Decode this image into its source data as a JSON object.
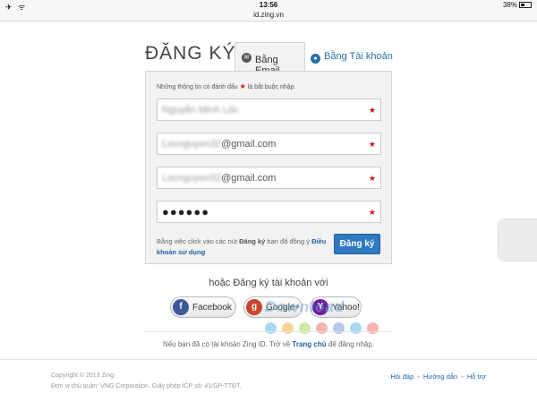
{
  "status_bar": {
    "signal": "✈ ᯤ",
    "time": "13:56",
    "battery": "38%"
  },
  "browser": {
    "url": "id.zing.vn"
  },
  "page": {
    "title": "ĐĂNG KÝ"
  },
  "tabs": [
    {
      "label": "Bằng Email",
      "icon": "mail-icon",
      "active": true
    },
    {
      "label": "Bằng Tài khoản",
      "icon": "user-icon",
      "active": false
    }
  ],
  "form": {
    "required_note_prefix": "Những thông tin có đánh dấu",
    "required_note_suffix": "là bắt buộc nhập.",
    "required_mark": "★",
    "fields": [
      {
        "name": "Nguyễn Minh Lộc",
        "visible_suffix": ""
      },
      {
        "prefix": "Locnguyen32",
        "visible_suffix": "@gmail.com"
      },
      {
        "prefix": "Locnguyen32",
        "visible_suffix": "@gmail.com"
      },
      {
        "masked": "●●●●●●"
      }
    ],
    "terms_prefix": "Bằng việc click vào các nút",
    "terms_bold": "Đăng ký",
    "terms_middle": "bạn đã đồng ý",
    "terms_link": "Điều khoản sử dụng",
    "submit_label": "Đăng ký"
  },
  "social": {
    "or_text": "hoặc Đăng ký tài khoản với",
    "buttons": [
      {
        "label": "Facebook",
        "glyph": "f",
        "color": "#3b5998"
      },
      {
        "label": "Google+",
        "glyph": "g",
        "color": "#c8452e"
      },
      {
        "label": "Yahoo!",
        "glyph": "Y",
        "color": "#6b1f9c"
      }
    ],
    "watermark": "Download"
  },
  "login_hint": {
    "prefix": "Nếu bạn đã có tài khoản Zing ID. Trở về",
    "link": "Trang chủ",
    "suffix": "để đăng nhập."
  },
  "footer": {
    "copyright": "Copyright © 2013 Zing",
    "company": "Đơn vị chủ quản: VNG Corporation. Giấy phép ICP số: 41/GP-TTĐT.",
    "links": [
      "Hỏi đáp",
      "Hướng dẫn",
      "Hỗ trợ"
    ]
  },
  "colors": {
    "accent": "#2f79c0",
    "required": "#d0111a",
    "link": "#1f5fa5"
  }
}
